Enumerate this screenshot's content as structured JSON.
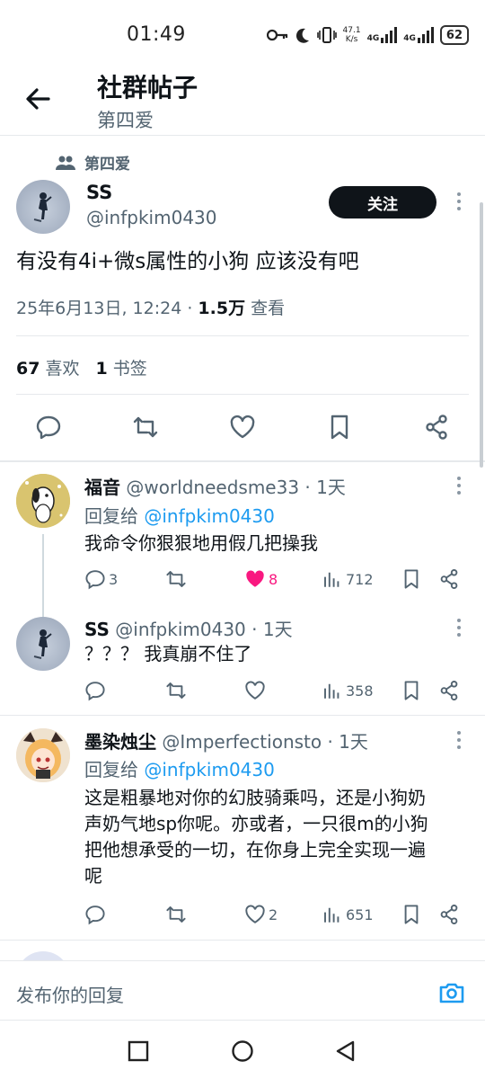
{
  "status_bar": {
    "time": "01:49",
    "speed_top": "47.1",
    "speed_bottom": "K/s",
    "net1": "4G",
    "net2": "4G",
    "battery": "62"
  },
  "header": {
    "title": "社群帖子",
    "subtitle": "第四爱"
  },
  "post": {
    "community": "第四爱",
    "author_name": "SS",
    "author_handle": "@infpkim0430",
    "follow_label": "关注",
    "text": "有没有4i+微s属性的小狗 应该没有吧",
    "datetime": "25年6月13日, 12:24 · ",
    "views": "1.5万",
    "views_label": " 查看",
    "likes_count": "67",
    "likes_label": "喜欢",
    "bookmarks_count": "1",
    "bookmarks_label": "书签"
  },
  "replies": [
    {
      "name": "福音",
      "handle": "@worldneedsme33 · 1天",
      "reply_to_prefix": "回复给 ",
      "reply_to": "@infpkim0430",
      "text": "我命令你狠狠地用假几把操我",
      "comments": "3",
      "retweets": "",
      "likes": "8",
      "views": "712"
    },
    {
      "name": "SS",
      "handle": "@infpkim0430 · 1天",
      "text": "？？？ 我真崩不住了",
      "comments": "",
      "retweets": "",
      "likes": "",
      "views": "358"
    },
    {
      "name": "墨染烛尘",
      "handle": "@Imperfectionsto · 1天",
      "reply_to_prefix": "回复给 ",
      "reply_to": "@infpkim0430",
      "text_lines": [
        "这是粗暴地对你的幻肢骑乘吗，还是小狗奶",
        "声奶气地sp你呢。亦或者，一只很m的小狗",
        "把他想承受的一切，在你身上完全实现一遍",
        "呢"
      ],
      "comments": "",
      "retweets": "",
      "likes": "2",
      "views": "651"
    }
  ],
  "compose": {
    "placeholder": "发布你的回复"
  },
  "colors": {
    "accent": "#1d9bf0",
    "like_active": "#f91880",
    "text_primary": "#0f1419",
    "text_secondary": "#536471"
  }
}
